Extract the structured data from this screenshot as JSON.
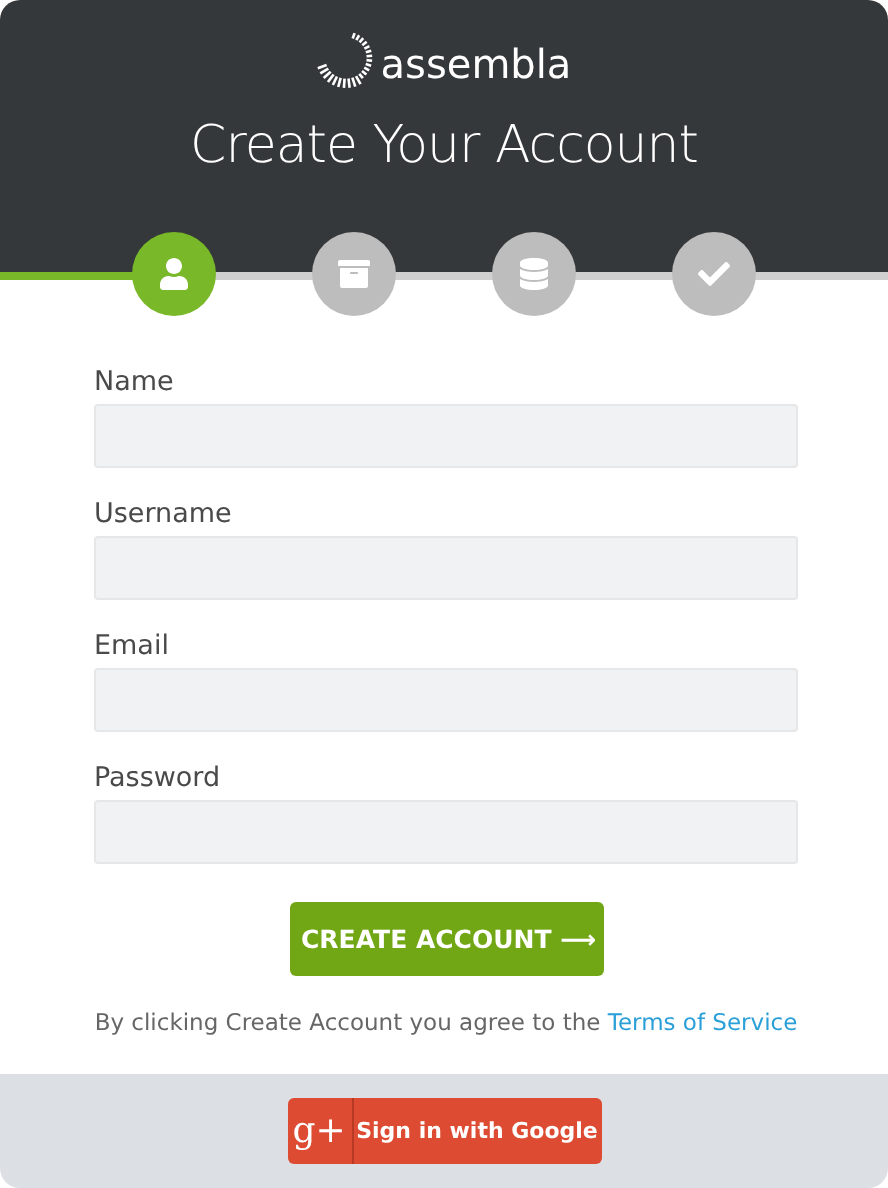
{
  "logo": {
    "text": "assembla"
  },
  "title": "Create Your Account",
  "steps": [
    {
      "kind": "user",
      "selected": true
    },
    {
      "kind": "box",
      "selected": false
    },
    {
      "kind": "database",
      "selected": false
    },
    {
      "kind": "check",
      "selected": false
    }
  ],
  "fields": [
    {
      "label": "Name"
    },
    {
      "label": "Username"
    },
    {
      "label": "Email"
    },
    {
      "label": "Password"
    }
  ],
  "submit": {
    "label": "CREATE ACCOUNT ⟶"
  },
  "agreement": {
    "text": "By clicking Create Account you agree to the",
    "link": "Terms of Service"
  },
  "google": {
    "mark": "g+",
    "label": "Sign in with Google"
  }
}
